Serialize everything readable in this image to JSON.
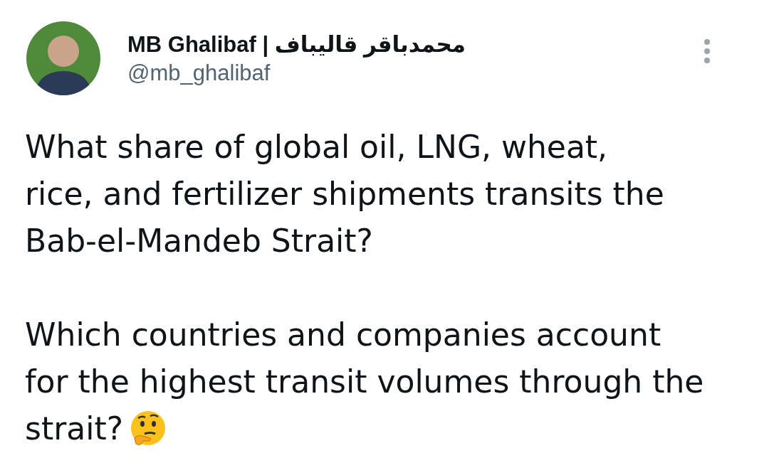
{
  "author": {
    "name": "MB Ghalibaf | محمدباقر قالیباف",
    "handle": "@mb_ghalibaf"
  },
  "paragraphs": [
    {
      "lines": [
        "What share of global oil, LNG, wheat,",
        "rice, and fertilizer shipments transits the",
        "Bab-el-Mandeb Strait?"
      ]
    },
    {
      "lines": [
        "Which countries and companies account",
        "for the highest transit volumes through the",
        "strait?"
      ]
    }
  ]
}
